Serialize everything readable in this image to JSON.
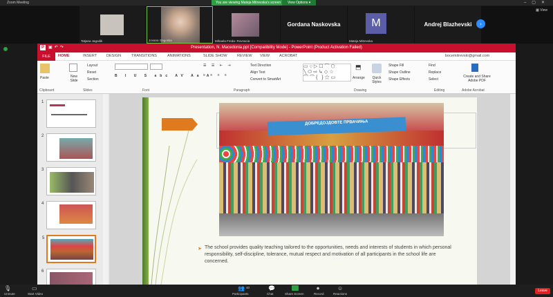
{
  "zoom": {
    "title": "Zoom Meeting",
    "share_banner": "You are viewing Mateja Mitrevska's screen",
    "view_options": "View Options ▾",
    "view_label": "View"
  },
  "participants": [
    {
      "name": "Tatjana Jagodik"
    },
    {
      "name": "Jovana Gagoska"
    },
    {
      "name": "Mihaela Freda- Rovnacia"
    },
    {
      "name": "Gordana Naskovska"
    },
    {
      "name": "Mateja Mitrevska",
      "initial": "M"
    },
    {
      "name": "Andrej Blazhevski"
    }
  ],
  "ppt": {
    "title": "Presentation, N. Macedonia.ppt [Compatibility Mode] -  PowerPoint (Product Activation Failed)",
    "user": "bocemitrevski@gmail.com",
    "tabs": [
      "FILE",
      "HOME",
      "INSERT",
      "DESIGN",
      "TRANSITIONS",
      "ANIMATIONS",
      "SLIDE SHOW",
      "REVIEW",
      "VIEW",
      "ACROBAT"
    ],
    "ribbon": {
      "paste": "Paste",
      "clipboard": "Clipboard",
      "new_slide": "New Slide",
      "layout": "Layout",
      "reset": "Reset",
      "section": "Section",
      "slides": "Slides",
      "font": "Font",
      "text_direction": "Text Direction",
      "align_text": "Align Text",
      "convert_smartart": "Convert to SmartArt",
      "paragraph": "Paragraph",
      "arrange": "Arrange",
      "quick_styles": "Quick Styles",
      "shape_fill": "Shape Fill",
      "shape_outline": "Shape Outline",
      "shape_effects": "Shape Effects",
      "drawing": "Drawing",
      "find": "Find",
      "replace": "Replace",
      "select": "Select",
      "editing": "Editing",
      "create_share": "Create and Share Adobe PDF",
      "adobe_acrobat": "Adobe Acrobat"
    },
    "thumbs": [
      "1",
      "2",
      "3",
      "4",
      "5",
      "6"
    ],
    "slide": {
      "banner_text": "ДОБРЕДОЈДОВТЕ ПРВАЧИЊА",
      "bullet": "The school provides quality teaching tailored to the opportunities, needs and interests of students in which personal responsibility, self-discipline, tolerance, mutual respect and motivation of all participants in the school life are concerned."
    }
  },
  "toolbar": {
    "unmute": "Unmute",
    "start_video": "Start Video",
    "participants": "Participants",
    "participants_count": "40",
    "chat": "Chat",
    "share_screen": "Share Screen",
    "record": "Record",
    "reactions": "Reactions",
    "leave": "Leave"
  }
}
